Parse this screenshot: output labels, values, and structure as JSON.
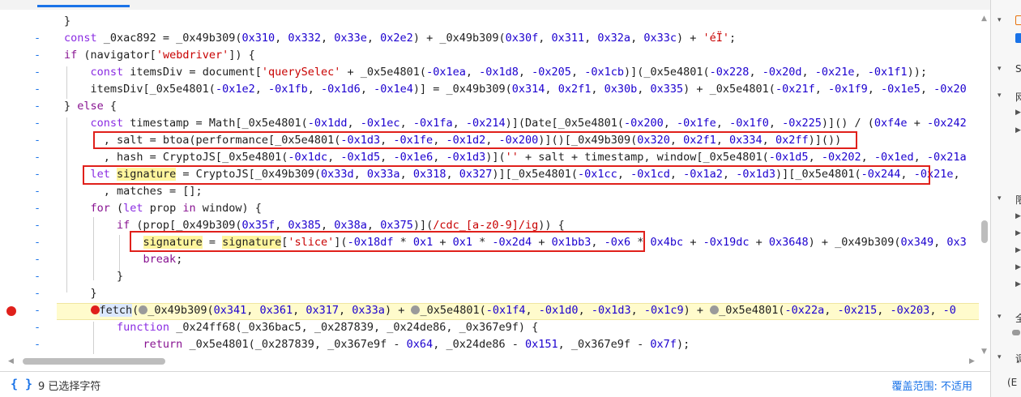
{
  "editor": {
    "lines": [
      {
        "marker": "",
        "html": "}"
      },
      {
        "marker": "-",
        "html": "<span class=\"kw\">const</span> _0xac892 = _0x49b309(<span class=\"num\">0x310</span>, <span class=\"num\">0x332</span>, <span class=\"num\">0x33e</span>, <span class=\"num\">0x2e2</span>) + _0x49b309(<span class=\"num\">0x30f</span>, <span class=\"num\">0x311</span>, <span class=\"num\">0x32a</span>, <span class=\"num\">0x33c</span>) + <span class=\"str\">'éÏ'</span>;"
      },
      {
        "marker": "-",
        "html": "<span class=\"kw2\">if</span> (navigator[<span class=\"str\">'webdriver'</span>]) {"
      },
      {
        "marker": "-",
        "html": "    <span class=\"kw\">const</span> itemsDiv = document[<span class=\"str\">'querySelec'</span> + _0x5e4801(<span class=\"num\">-0x1ea</span>, <span class=\"num\">-0x1d8</span>, <span class=\"num\">-0x205</span>, <span class=\"num\">-0x1cb</span>)](_0x5e4801(<span class=\"num\">-0x228</span>, <span class=\"num\">-0x20d</span>, <span class=\"num\">-0x21e</span>, <span class=\"num\">-0x1f1</span>));"
      },
      {
        "marker": "-",
        "html": "    itemsDiv[_0x5e4801(<span class=\"num\">-0x1e2</span>, <span class=\"num\">-0x1fb</span>, <span class=\"num\">-0x1d6</span>, <span class=\"num\">-0x1e4</span>)] = _0x49b309(<span class=\"num\">0x314</span>, <span class=\"num\">0x2f1</span>, <span class=\"num\">0x30b</span>, <span class=\"num\">0x335</span>) + _0x5e4801(<span class=\"num\">-0x21f</span>, <span class=\"num\">-0x1f9</span>, <span class=\"num\">-0x1e5</span>, <span class=\"num\">-0x20</span>"
      },
      {
        "marker": "-",
        "html": "} <span class=\"kw2\">else</span> {"
      },
      {
        "marker": "-",
        "html": "    <span class=\"kw\">const</span> timestamp = Math[_0x5e4801(<span class=\"num\">-0x1dd</span>, <span class=\"num\">-0x1ec</span>, <span class=\"num\">-0x1fa</span>, <span class=\"num\">-0x214</span>)](Date[_0x5e4801(<span class=\"num\">-0x200</span>, <span class=\"num\">-0x1fe</span>, <span class=\"num\">-0x1f0</span>, <span class=\"num\">-0x225</span>)]() / (<span class=\"num\">0xf4e</span> + <span class=\"num\">-0x242</span>"
      },
      {
        "marker": "-",
        "html": "      , salt = btoa(performance[_0x5e4801(<span class=\"num\">-0x1d3</span>, <span class=\"num\">-0x1fe</span>, <span class=\"num\">-0x1d2</span>, <span class=\"num\">-0x200</span>)]()[_0x49b309(<span class=\"num\">0x320</span>, <span class=\"num\">0x2f1</span>, <span class=\"num\">0x334</span>, <span class=\"num\">0x2ff</span>)]())"
      },
      {
        "marker": "-",
        "html": "      , hash = CryptoJS[_0x5e4801(<span class=\"num\">-0x1dc</span>, <span class=\"num\">-0x1d5</span>, <span class=\"num\">-0x1e6</span>, <span class=\"num\">-0x1d3</span>)](<span class=\"str\">''</span> + salt + timestamp, window[_0x5e4801(<span class=\"num\">-0x1d5</span>, <span class=\"num\">-0x202</span>, <span class=\"num\">-0x1ed</span>, <span class=\"num\">-0x21a</span>"
      },
      {
        "marker": "-",
        "html": "    <span class=\"kw\">let</span> <span class=\"hl\">signature</span> = CryptoJS[_0x49b309(<span class=\"num\">0x33d</span>, <span class=\"num\">0x33a</span>, <span class=\"num\">0x318</span>, <span class=\"num\">0x327</span>)][_0x5e4801(<span class=\"num\">-0x1cc</span>, <span class=\"num\">-0x1cd</span>, <span class=\"num\">-0x1a2</span>, <span class=\"num\">-0x1d3</span>)][_0x5e4801(<span class=\"num\">-0x244</span>, <span class=\"num\">-0x21e</span>,"
      },
      {
        "marker": "-",
        "html": "      , matches = [];"
      },
      {
        "marker": "-",
        "html": "    <span class=\"kw2\">for</span> (<span class=\"kw\">let</span> prop <span class=\"kw2\">in</span> window) {"
      },
      {
        "marker": "-",
        "html": "        <span class=\"kw2\">if</span> (prop[_0x49b309(<span class=\"num\">0x35f</span>, <span class=\"num\">0x385</span>, <span class=\"num\">0x38a</span>, <span class=\"num\">0x375</span>)](<span class=\"str\">/cdc_[a-z0-9]/ig</span>)) {"
      },
      {
        "marker": "-",
        "html": "            <span class=\"hl\">signature</span> = <span class=\"hl\">signature</span>[<span class=\"str\">'slice'</span>](<span class=\"num\">-0x18df</span> * <span class=\"num\">0x1</span> + <span class=\"num\">0x1</span> * <span class=\"num\">-0x2d4</span> + <span class=\"num\">0x1bb3</span>, <span class=\"num\">-0x6</span> * <span class=\"num\">0x4bc</span> + <span class=\"num\">-0x19dc</span> + <span class=\"num\">0x3648</span>) + _0x49b309(<span class=\"num\">0x349</span>, <span class=\"num\">0x3</span>"
      },
      {
        "marker": "-",
        "html": "            <span class=\"kw2\">break</span>;"
      },
      {
        "marker": "-",
        "html": "        }"
      },
      {
        "marker": "-",
        "html": "    }"
      },
      {
        "marker": "-",
        "html": "    <span class=\"inline-bp\"></span><span style=\"background:#dbe8ff\">fetch</span>(<span class=\"gray-dot\"></span>_0x49b309(<span class=\"num\">0x341</span>, <span class=\"num\">0x361</span>, <span class=\"num\">0x317</span>, <span class=\"num\">0x33a</span>) + <span class=\"gray-dot\"></span>_0x5e4801(<span class=\"num\">-0x1f4</span>, <span class=\"num\">-0x1d0</span>, <span class=\"num\">-0x1d3</span>, <span class=\"num\">-0x1c9</span>) + <span class=\"gray-dot\"></span>_0x5e4801(<span class=\"num\">-0x22a</span>, <span class=\"num\">-0x215</span>, <span class=\"num\">-0x203</span>, <span class=\"num\">-0</span>"
      },
      {
        "marker": "-",
        "html": "        <span class=\"kw\">function</span> _0x24ff68(_0x36bac5, _0x287839, _0x24de86, _0x367e9f) {"
      },
      {
        "marker": "-",
        "html": "            <span class=\"kw2\">return</span> _0x5e4801(_0x287839, _0x367e9f - <span class=\"num\">0x64</span>, _0x24de86 - <span class=\"num\">0x151</span>, _0x367e9f - <span class=\"num\">0x7f</span>);"
      }
    ]
  },
  "statusbar": {
    "braces": "{ }",
    "selection": "9 已选择字符",
    "coverage": "覆盖范围: 不适用"
  },
  "right_panel": {
    "items": [
      {
        "chev": "▾",
        "text": "S"
      },
      {
        "chev": "▾",
        "text": "网"
      },
      {
        "chev": "▾",
        "text": "限"
      },
      {
        "chev": "▾",
        "text": "全"
      },
      {
        "chev": "▾",
        "text": "调"
      },
      {
        "chev": "",
        "text": "(E"
      }
    ]
  },
  "icons": {
    "breakpoint": "breakpoint-icon",
    "braces": "braces-icon"
  }
}
